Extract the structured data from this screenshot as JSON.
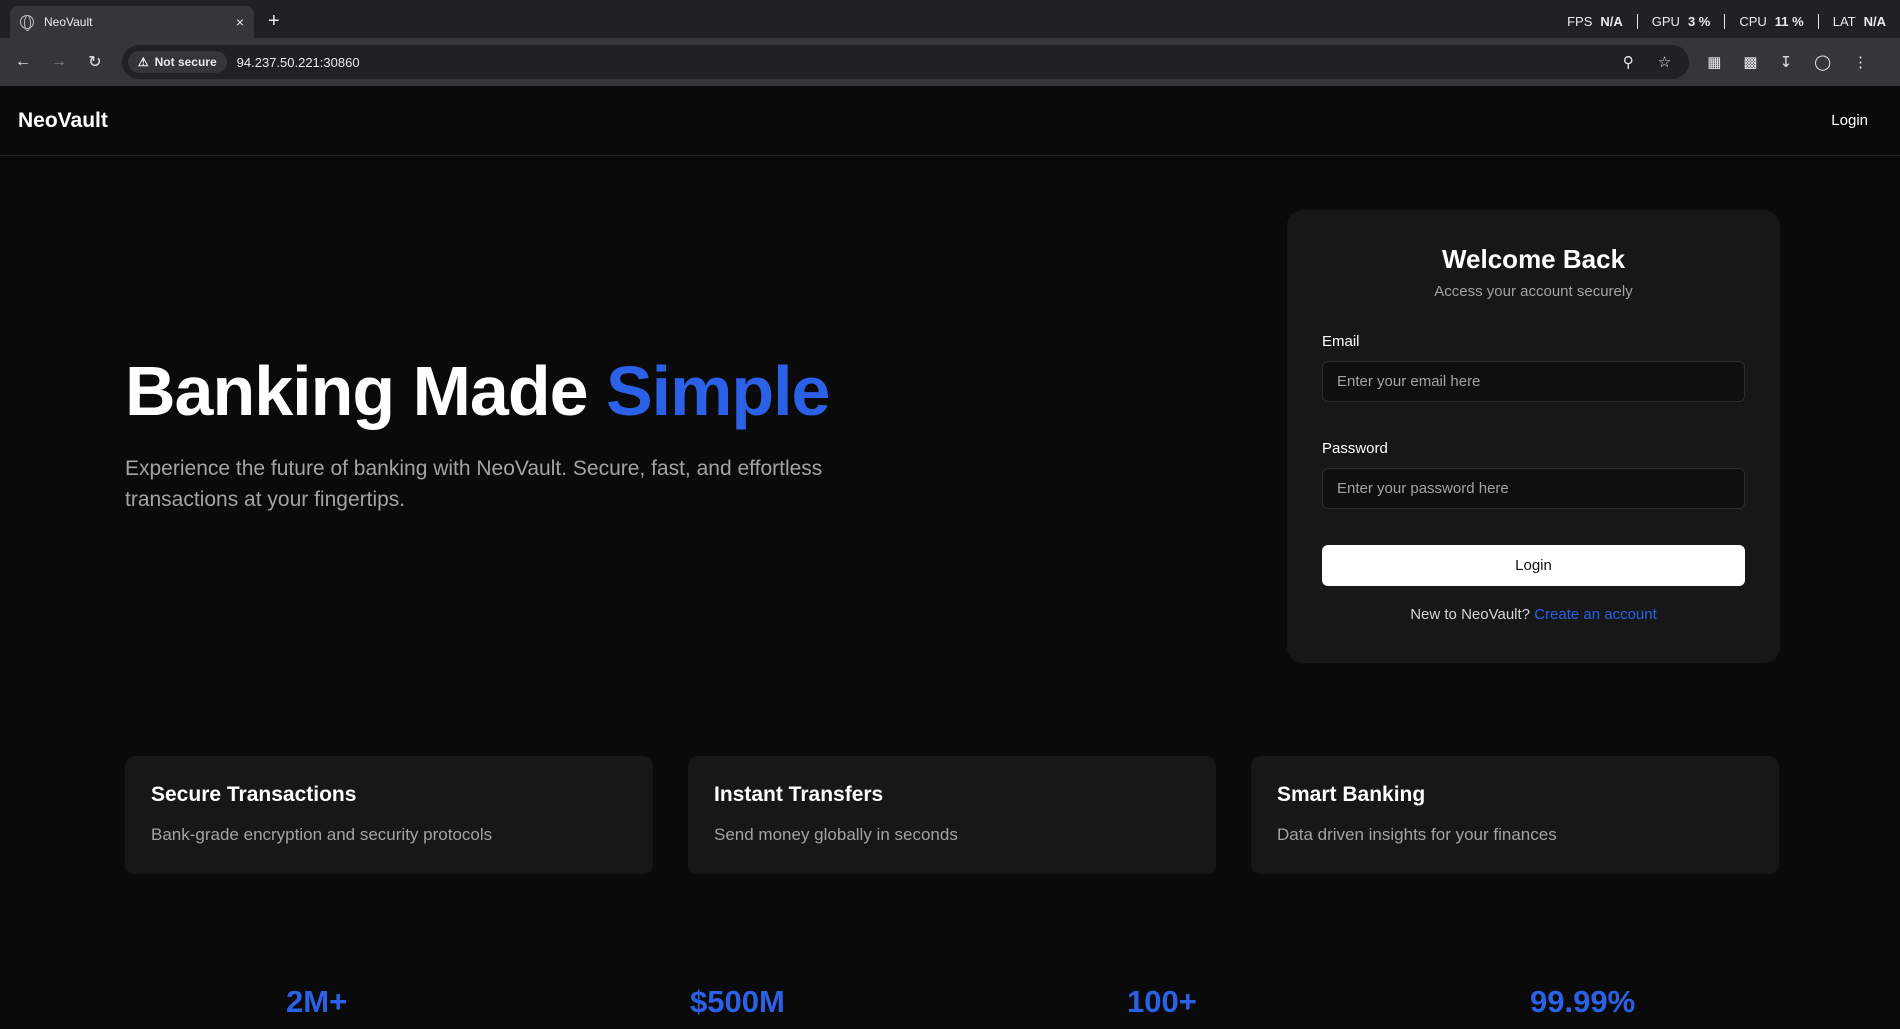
{
  "browser": {
    "tab_title": "NeoVault",
    "tab_close": "×",
    "new_tab": "+",
    "perf": [
      {
        "label": "FPS",
        "value": "N/A"
      },
      {
        "label": "GPU",
        "value": "3 %"
      },
      {
        "label": "CPU",
        "value": "11 %"
      },
      {
        "label": "LAT",
        "value": "N/A"
      }
    ],
    "security_label": "Not secure",
    "url": "94.237.50.221:30860"
  },
  "navbar": {
    "brand": "NeoVault",
    "login_link": "Login"
  },
  "hero": {
    "title_main": "Banking Made ",
    "title_accent": "Simple",
    "subtitle": "Experience the future of banking with NeoVault. Secure, fast, and effortless transactions at your fingertips."
  },
  "login_card": {
    "title": "Welcome Back",
    "subtitle": "Access your account securely",
    "email_label": "Email",
    "email_placeholder": "Enter your email here",
    "email_value": "",
    "password_label": "Password",
    "password_placeholder": "Enter your password here",
    "password_value": "",
    "submit_label": "Login",
    "signup_prompt": "New to NeoVault? ",
    "signup_link": "Create an account"
  },
  "features": [
    {
      "title": "Secure Transactions",
      "description": "Bank-grade encryption and security protocols"
    },
    {
      "title": "Instant Transfers",
      "description": "Send money globally in seconds"
    },
    {
      "title": "Smart Banking",
      "description": "Data driven insights for your finances"
    }
  ],
  "stats": [
    "2M+",
    "$500M",
    "100+",
    "99.99%"
  ],
  "colors": {
    "accent": "#2b61e6",
    "background": "#0a0a0a",
    "card": "#171717"
  }
}
